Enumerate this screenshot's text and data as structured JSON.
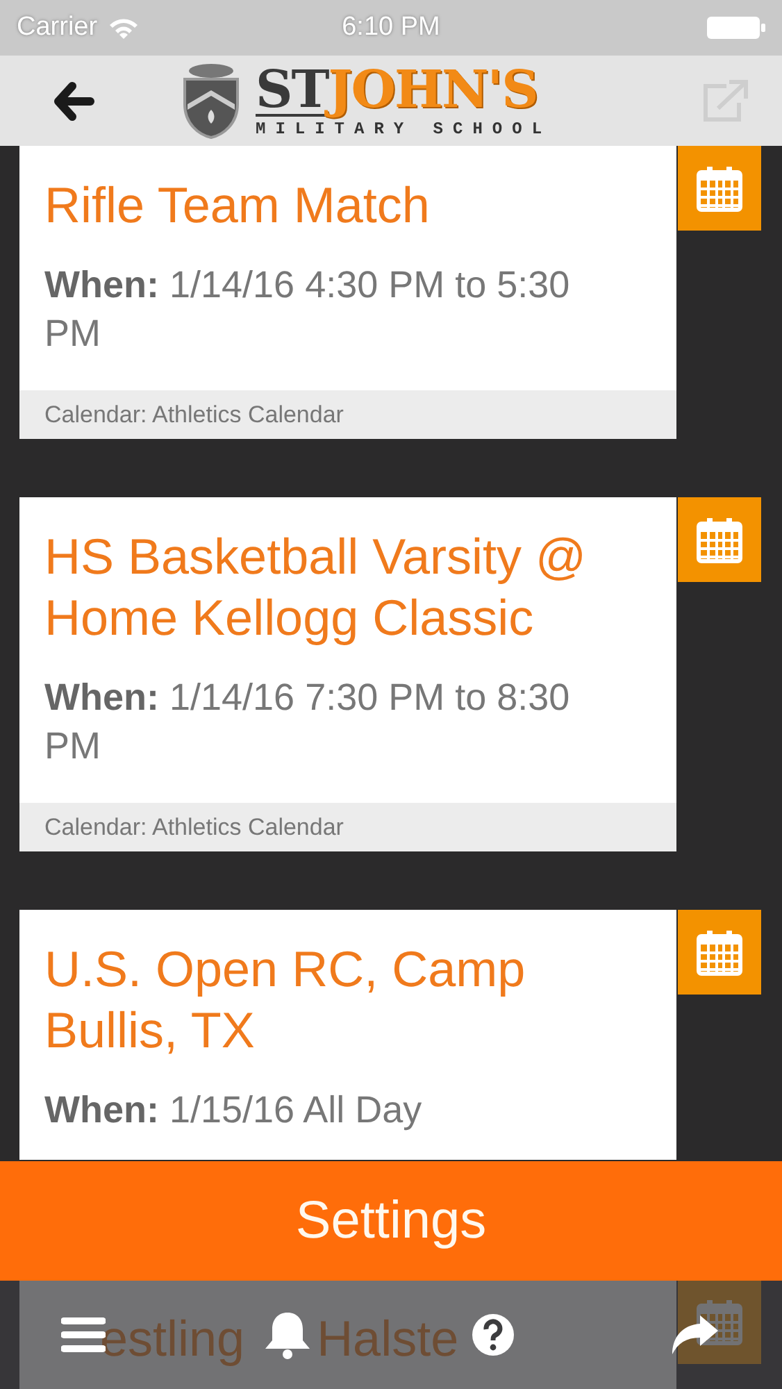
{
  "status_bar": {
    "carrier": "Carrier",
    "time": "6:10 PM"
  },
  "header": {
    "logo": {
      "word_1": "ST",
      "word_2": "JOHN'S",
      "subtitle": "MILITARY SCHOOL"
    },
    "share_disabled": true
  },
  "events": [
    {
      "title": "Rifle Team Match",
      "when": "**When:** 1/14/16 4:30 PM to 5:30 PM",
      "calendar": "Calendar: Athletics Calendar"
    },
    {
      "title": "HS Basketball Varsity @ Home Kellogg Classic",
      "when": "**When:** 1/14/16 7:30 PM to 8:30 PM",
      "calendar": "Calendar: Athletics Calendar"
    },
    {
      "title": "U.S. Open RC, Camp Bullis, TX",
      "when": "**When:** 1/15/16 All Day"
    },
    {
      "title_fragments": [
        "estling",
        "Halste"
      ]
    }
  ],
  "settings_button": "Settings",
  "tab_bar": [
    {
      "kind": "menu"
    },
    {
      "kind": "bell"
    },
    {
      "kind": "help"
    },
    {
      "kind": "share"
    }
  ]
}
